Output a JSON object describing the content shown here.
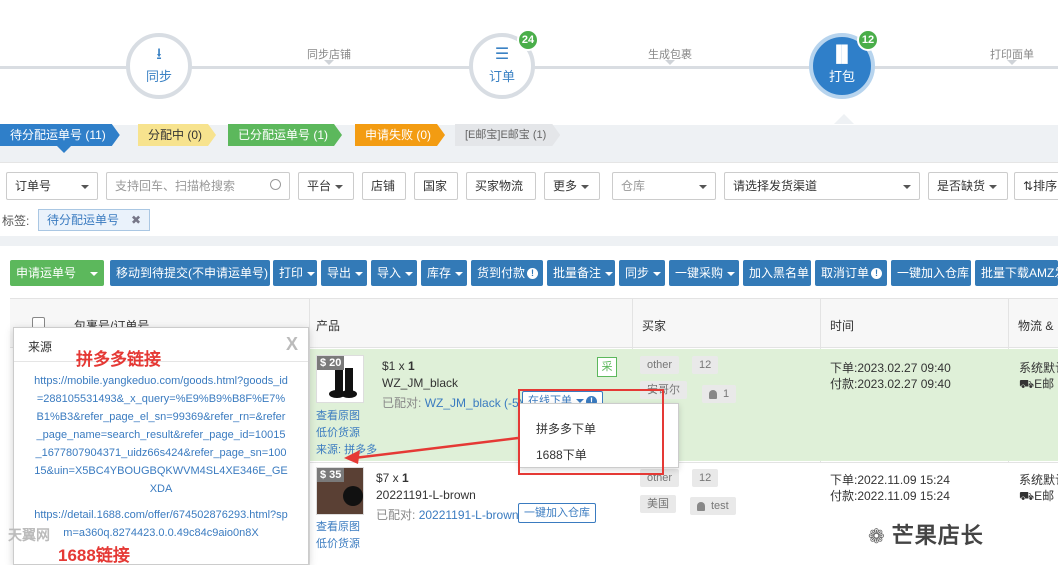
{
  "stepper": {
    "steps": [
      {
        "label": "同步",
        "icon": "download-icon",
        "badge": ""
      },
      {
        "label": "订单",
        "icon": "list-icon",
        "badge": "24"
      },
      {
        "label": "打包",
        "icon": "barcode-icon",
        "badge": "12"
      }
    ],
    "connectors": [
      "同步店铺",
      "生成包裹",
      "打印面单"
    ]
  },
  "status_tabs": [
    {
      "label": "待分配运单号 (11)",
      "color": "blue"
    },
    {
      "label": "分配中 (0)",
      "color": "yellow"
    },
    {
      "label": "已分配运单号 (1)",
      "color": "green"
    },
    {
      "label": "申请失败 (0)",
      "color": "orange"
    },
    {
      "label": "[E邮宝]E邮宝 (1)",
      "color": "gray"
    }
  ],
  "filters": {
    "order_no": "订单号",
    "search_placeholder": "支持回车、扫描枪搜索",
    "platform": "平台",
    "shop": "店铺",
    "country": "国家",
    "buyer_logistics": "买家物流",
    "more": "更多",
    "warehouse": "仓库",
    "channel": "请选择发货渠道",
    "out_of_stock": "是否缺货",
    "sort": "排序",
    "tag_label": "标签:",
    "tag_value": "待分配运单号"
  },
  "toolbar": {
    "apply_tracking": "申请运单号",
    "move_pending": "移动到待提交(不申请运单号)",
    "print": "打印",
    "export": "导出",
    "import": "导入",
    "stock": "库存",
    "cod": "货到付款",
    "batch_note": "批量备注",
    "sync": "同步",
    "one_click_purchase": "一键采购",
    "add_blacklist": "加入黑名单",
    "cancel_order": "取消订单",
    "add_to_warehouse": "一键加入仓库",
    "batch_download": "批量下载AMZ发"
  },
  "table": {
    "headers": {
      "package": "包裹号/订单号",
      "product": "产品",
      "buyer": "买家",
      "time": "时间",
      "logistics": "物流 &"
    },
    "rows": [
      {
        "price_tag": "$ 20",
        "unit_price": "$1 x",
        "qty": "1",
        "sku": "WZ_JM_black",
        "matched_label": "已配对:",
        "matched_sku": "WZ_JM_black",
        "matched_suffix": "(-5)",
        "online_order_btn": "在线下单",
        "links": [
          "查看原图",
          "低价货源",
          "来源: 拼多多"
        ],
        "purchase_badge": "采",
        "buyer_name": "other",
        "buyer_count": "12",
        "country": "安哥尔",
        "user_count": "1",
        "order_time": "下单:2023.02.27 09:40",
        "pay_time": "付款:2023.02.27 09:40",
        "logistics": "系统默认",
        "logistics_sub": "E邮"
      },
      {
        "price_tag": "$ 35",
        "unit_price": "$7 x",
        "qty": "1",
        "sku": "20221191-L-brown",
        "matched_label": "已配对:",
        "matched_sku": "20221191-L-brown",
        "add_warehouse_btn": "一键加入仓库",
        "links": [
          "查看原图",
          "低价货源"
        ],
        "buyer_name": "other",
        "buyer_count": "12",
        "country": "美国",
        "user_name": "test",
        "order_time": "下单:2022.11.09 15:24",
        "pay_time": "付款:2022.11.09 15:24",
        "logistics": "系统默认",
        "logistics_sub": "E邮"
      }
    ]
  },
  "dropdown": {
    "options": [
      "拼多多下单",
      "1688下单"
    ]
  },
  "source_panel": {
    "title": "来源",
    "annotation_pdd": "拼多多链接",
    "url_pdd": "https://mobile.yangkeduo.com/goods.html?goods_id=288105531493&_x_query=%E9%B9%B8F%E7%B1%B3&refer_page_el_sn=99369&refer_rn=&refer_page_name=search_result&refer_page_id=10015_1677807904371_uidz66s424&refer_page_sn=10015&uin=X5BC4YBOUGBQKWVM4SL4XE346E_GEXDA",
    "url_1688": "https://detail.1688.com/offer/674502876293.html?spm=a360q.8274423.0.0.49c84c9aio0n8X",
    "annotation_1688": "1688链接"
  },
  "watermark": {
    "text": "芒果店长",
    "left_text": "天翼网"
  },
  "colors": {
    "primary": "#337ab7",
    "success": "#5cb85c",
    "warning": "#f39c12",
    "annotation_red": "#e53935"
  }
}
